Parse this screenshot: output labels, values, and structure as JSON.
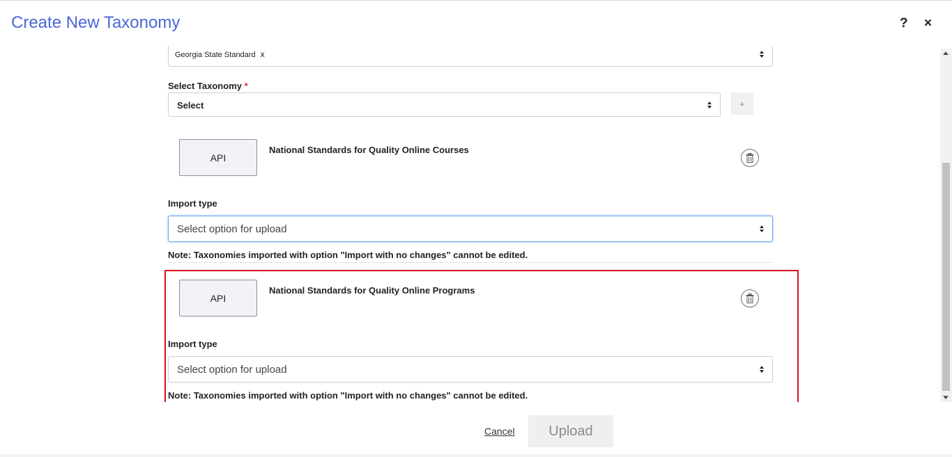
{
  "header": {
    "title": "Create New Taxonomy",
    "help_label": "?",
    "close_label": "×"
  },
  "source_select": {
    "tag": "Georgia State Standard",
    "tag_remove": "x"
  },
  "taxonomy_select": {
    "label": "Select Taxonomy",
    "required_mark": "*",
    "value": "Select",
    "add_label": "+"
  },
  "items": [
    {
      "source": "API",
      "name": "National Standards for Quality Online Courses",
      "import_label": "Import type",
      "import_placeholder": "Select option for upload",
      "note": "Note: Taxonomies imported with option \"Import with no changes\" cannot be edited."
    },
    {
      "source": "API",
      "name": "National Standards for Quality Online Programs",
      "import_label": "Import type",
      "import_placeholder": "Select option for upload",
      "note": "Note: Taxonomies imported with option \"Import with no changes\" cannot be edited."
    }
  ],
  "footer": {
    "cancel_label": "Cancel",
    "upload_label": "Upload"
  },
  "colors": {
    "title": "#4a67d6",
    "highlight": "#d8121b",
    "focus_border": "#6aa4e8"
  }
}
